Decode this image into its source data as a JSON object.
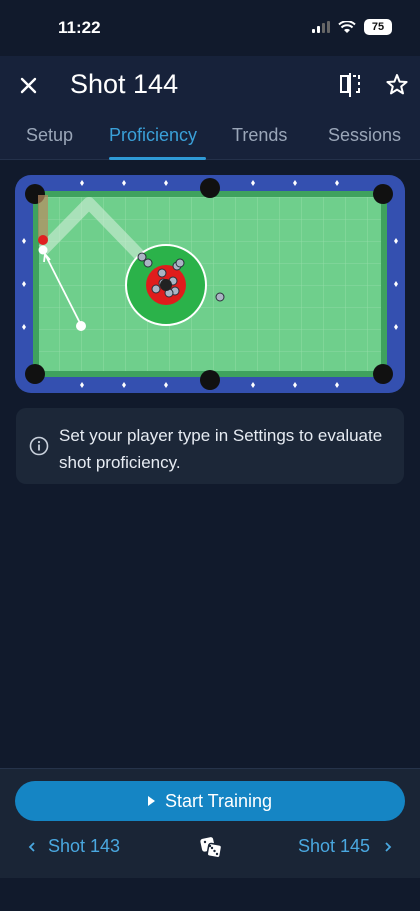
{
  "status": {
    "time": "11:22",
    "battery": "75"
  },
  "header": {
    "title": "Shot 144"
  },
  "tabs": [
    {
      "label": "Setup"
    },
    {
      "label": "Proficiency"
    },
    {
      "label": "Trends"
    },
    {
      "label": "Sessions"
    }
  ],
  "info": {
    "message": "Set your player type in Settings to evaluate shot proficiency."
  },
  "actions": {
    "start_label": "Start Training"
  },
  "navigation": {
    "prev_label": "Shot 143",
    "next_label": "Shot 145"
  },
  "colors": {
    "accent": "#2f9ad6",
    "felt": "#6fcf8c",
    "rail": "#3450b0",
    "target_outer": "#2bb24a",
    "target_inner": "#e01c1c"
  },
  "icons": [
    "close-icon",
    "compare-icon",
    "star-icon",
    "info-icon",
    "play-icon",
    "chevron-left-icon",
    "dice-icon",
    "chevron-right-icon"
  ]
}
